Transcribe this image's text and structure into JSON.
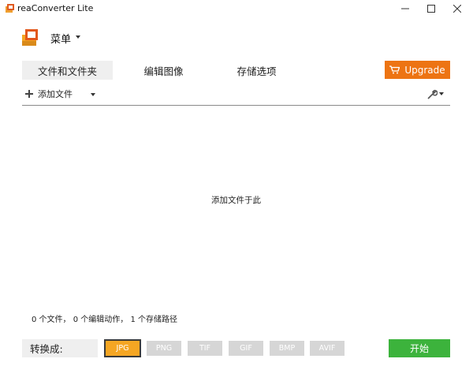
{
  "window": {
    "title": "reaConverter Lite"
  },
  "menu": {
    "label": "菜单"
  },
  "tabs": [
    {
      "label": "文件和文件夹"
    },
    {
      "label": "编辑图像"
    },
    {
      "label": "存储选项"
    }
  ],
  "upgrade": {
    "label": "Upgrade"
  },
  "toolbar": {
    "add_files_label": "添加文件"
  },
  "drop_area": {
    "hint": "添加文件于此"
  },
  "status": {
    "text": "0 个文件， 0 个编辑动作， 1 个存储路径"
  },
  "bottom": {
    "convert_label": "转换成:",
    "formats": [
      {
        "label": "JPG",
        "selected": true
      },
      {
        "label": "PNG",
        "selected": false
      },
      {
        "label": "TIF",
        "selected": false
      },
      {
        "label": "GIF",
        "selected": false
      },
      {
        "label": "BMP",
        "selected": false
      },
      {
        "label": "AVIF",
        "selected": false
      }
    ],
    "start_label": "开始"
  },
  "colors": {
    "upgrade": "#ed7413",
    "start": "#3cb33c",
    "selected_format": "#f5a623",
    "format_inactive": "#d6d6d6"
  }
}
